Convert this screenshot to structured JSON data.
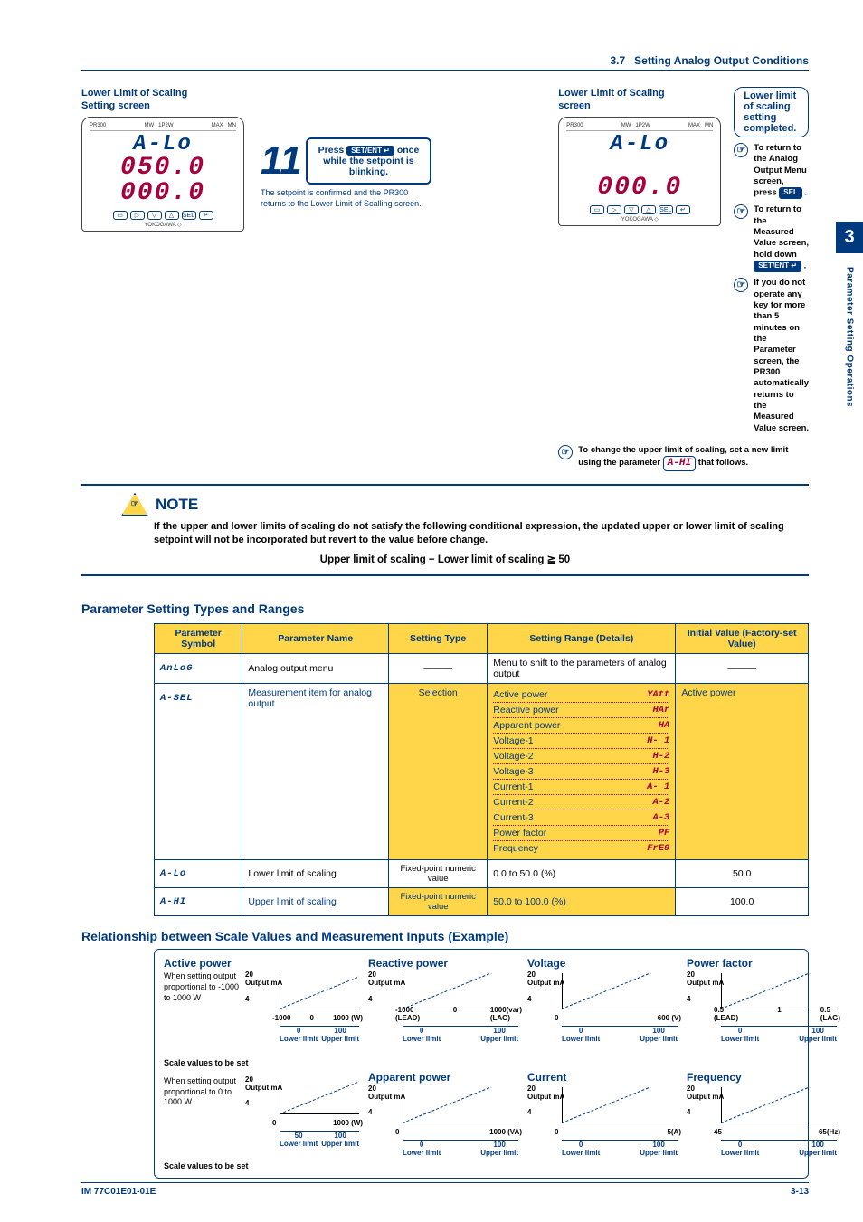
{
  "header": {
    "section_no": "3.7",
    "section_title": "Setting Analog Output Conditions"
  },
  "side": {
    "chapter": "3",
    "label": "Parameter Setting Operations"
  },
  "left_screen": {
    "title1": "Lower Limit of Scaling",
    "title2": "Setting screen",
    "seg1": "A-Lo",
    "seg2": "050.0",
    "seg3": "000.0",
    "step_num": "11",
    "instr_pre": "Press",
    "instr_key": "SET/ENT ↵",
    "instr_post": "once while the setpoint is blinking.",
    "step_note": "The setpoint is confirmed and the PR300 returns to the Lower Limit of Scalling screen."
  },
  "right_screen": {
    "title1": "Lower Limit of Scaling",
    "title2": "screen",
    "seg1": "A-Lo",
    "seg2": "000.0",
    "completed": "Lower limit of scaling setting completed.",
    "tips": [
      {
        "pre": "To return to the Analog Output Menu screen, press",
        "key": "SEL",
        "post": "."
      },
      {
        "pre": "To return to the Measured Value screen, hold down",
        "key": "SET/ENT ↵",
        "post": "."
      },
      {
        "text": "If you do not operate any key for more than 5 minutes on the Parameter screen, the PR300 automatically returns to the Measured Value screen."
      }
    ],
    "change_upper_pre": "To change the upper limit of scaling, set a new limit using the parameter",
    "change_upper_sym": "A-HI",
    "change_upper_post": "that follows."
  },
  "note": {
    "title": "NOTE",
    "text": "If the upper and lower limits of scaling do not satisfy the following conditional expression, the updated upper or lower limit of scaling setpoint will not be incorporated but revert to the value before change.",
    "formula": "Upper limit of scaling − Lower limit  of scaling ≧ 50"
  },
  "param_section_title": "Parameter Setting Types and Ranges",
  "table": {
    "headers": [
      "Parameter Symbol",
      "Parameter Name",
      "Setting Type",
      "Setting Range (Details)",
      "Initial Value (Factory-set Value)"
    ],
    "rows": [
      {
        "sym": "AnLoG",
        "name": "Analog output menu",
        "type": "———",
        "range_text": "Menu to shift to the parameters of analog output",
        "init": "———"
      },
      {
        "sym": "A-SEL",
        "name": "Measurement item for analog output",
        "type": "Selection",
        "options": [
          {
            "label": "Active power",
            "sym": "YAtt"
          },
          {
            "label": "Reactive power",
            "sym": "HAr"
          },
          {
            "label": "Apparent power",
            "sym": "HA"
          },
          {
            "label": "Voltage-1",
            "sym": "H- 1"
          },
          {
            "label": "Voltage-2",
            "sym": "H-2"
          },
          {
            "label": "Voltage-3",
            "sym": "H-3"
          },
          {
            "label": "Current-1",
            "sym": "A- 1"
          },
          {
            "label": "Current-2",
            "sym": "A-2"
          },
          {
            "label": "Current-3",
            "sym": "A-3"
          },
          {
            "label": "Power factor",
            "sym": "PF"
          },
          {
            "label": "Frequency",
            "sym": "FrE9"
          }
        ],
        "init": "Active power"
      },
      {
        "sym": "A-Lo",
        "name": "Lower limit of scaling",
        "type": "Fixed-point numeric value",
        "range_text": "0.0 to 50.0 (%)",
        "init": "50.0"
      },
      {
        "sym": "A-HI",
        "name": "Upper limit of scaling",
        "type": "Fixed-point numeric value",
        "range_text": "50.0 to 100.0 (%)",
        "init": "100.0"
      }
    ]
  },
  "rel_title": "Relationship between Scale Values and Measurement Inputs (Example)",
  "graphs": {
    "active": {
      "title": "Active power",
      "info1": "When setting output proportional to -1000 to 1000 W",
      "info2": "When setting output proportional to 0 to 1000 W",
      "y_top": "20",
      "y_bot": "4",
      "out": "Output mA",
      "x1": "-1000",
      "x2": "0",
      "x3": "1000 (W)",
      "s_lo": "0",
      "s_hi": "100",
      "scale_label": "Scale values to be set",
      "x1b": "0",
      "x3b": "1000 (W)",
      "s_lob": "50",
      "s_hib": "100",
      "lower": "Lower limit",
      "upper": "Upper limit"
    },
    "reactive": {
      "title": "Reactive power",
      "x1": "-1000",
      "x2": "0",
      "x3": "1000(var)",
      "lead": "(LEAD)",
      "lag": "(LAG)",
      "s_lo": "0",
      "s_hi": "100"
    },
    "apparent": {
      "title": "Apparent power",
      "x1": "0",
      "x3": "1000 (VA)",
      "s_lo": "0",
      "s_hi": "100"
    },
    "voltage": {
      "title": "Voltage",
      "x1": "0",
      "x3": "600 (V)",
      "s_lo": "0",
      "s_hi": "100"
    },
    "current": {
      "title": "Current",
      "x1": "0",
      "x3": "5(A)",
      "s_lo": "0",
      "s_hi": "100"
    },
    "pf": {
      "title": "Power factor",
      "x1": "0.5",
      "x2": "1",
      "x3": "0.5",
      "lead": "(LEAD)",
      "lag": "(LAG)",
      "s_lo": "0",
      "s_hi": "100"
    },
    "freq": {
      "title": "Frequency",
      "x1": "45",
      "x3": "65(Hz)",
      "s_lo": "0",
      "s_hi": "100"
    },
    "common": {
      "y_top": "20",
      "y_bot": "4",
      "out": "Output mA",
      "lower": "Lower limit",
      "upper": "Upper limit"
    }
  },
  "footer": {
    "doc": "IM 77C01E01-01E",
    "page": "3-13"
  },
  "chart_data": [
    {
      "type": "line",
      "title": "Active power (−1000 to 1000 W)",
      "xlabel": "W",
      "ylabel": "Output mA",
      "x": [
        -1000,
        1000
      ],
      "y": [
        4,
        20
      ],
      "scale_lower": 0,
      "scale_upper": 100
    },
    {
      "type": "line",
      "title": "Active power (0 to 1000 W)",
      "xlabel": "W",
      "ylabel": "Output mA",
      "x": [
        0,
        1000
      ],
      "y": [
        4,
        20
      ],
      "scale_lower": 50,
      "scale_upper": 100
    },
    {
      "type": "line",
      "title": "Reactive power",
      "xlabel": "var",
      "ylabel": "Output mA",
      "x": [
        -1000,
        1000
      ],
      "y": [
        4,
        20
      ],
      "scale_lower": 0,
      "scale_upper": 100,
      "note": "LEAD/LAG"
    },
    {
      "type": "line",
      "title": "Apparent power",
      "xlabel": "VA",
      "ylabel": "Output mA",
      "x": [
        0,
        1000
      ],
      "y": [
        4,
        20
      ],
      "scale_lower": 0,
      "scale_upper": 100
    },
    {
      "type": "line",
      "title": "Voltage",
      "xlabel": "V",
      "ylabel": "Output mA",
      "x": [
        0,
        600
      ],
      "y": [
        4,
        20
      ],
      "scale_lower": 0,
      "scale_upper": 100
    },
    {
      "type": "line",
      "title": "Current",
      "xlabel": "A",
      "ylabel": "Output mA",
      "x": [
        0,
        5
      ],
      "y": [
        4,
        20
      ],
      "scale_lower": 0,
      "scale_upper": 100
    },
    {
      "type": "line",
      "title": "Power factor",
      "xlabel": "PF",
      "ylabel": "Output mA",
      "x": [
        0.5,
        1,
        0.5
      ],
      "y": [
        4,
        12,
        20
      ],
      "scale_lower": 0,
      "scale_upper": 100,
      "note": "LEAD→1→LAG"
    },
    {
      "type": "line",
      "title": "Frequency",
      "xlabel": "Hz",
      "ylabel": "Output mA",
      "x": [
        45,
        65
      ],
      "y": [
        4,
        20
      ],
      "scale_lower": 0,
      "scale_upper": 100
    }
  ]
}
